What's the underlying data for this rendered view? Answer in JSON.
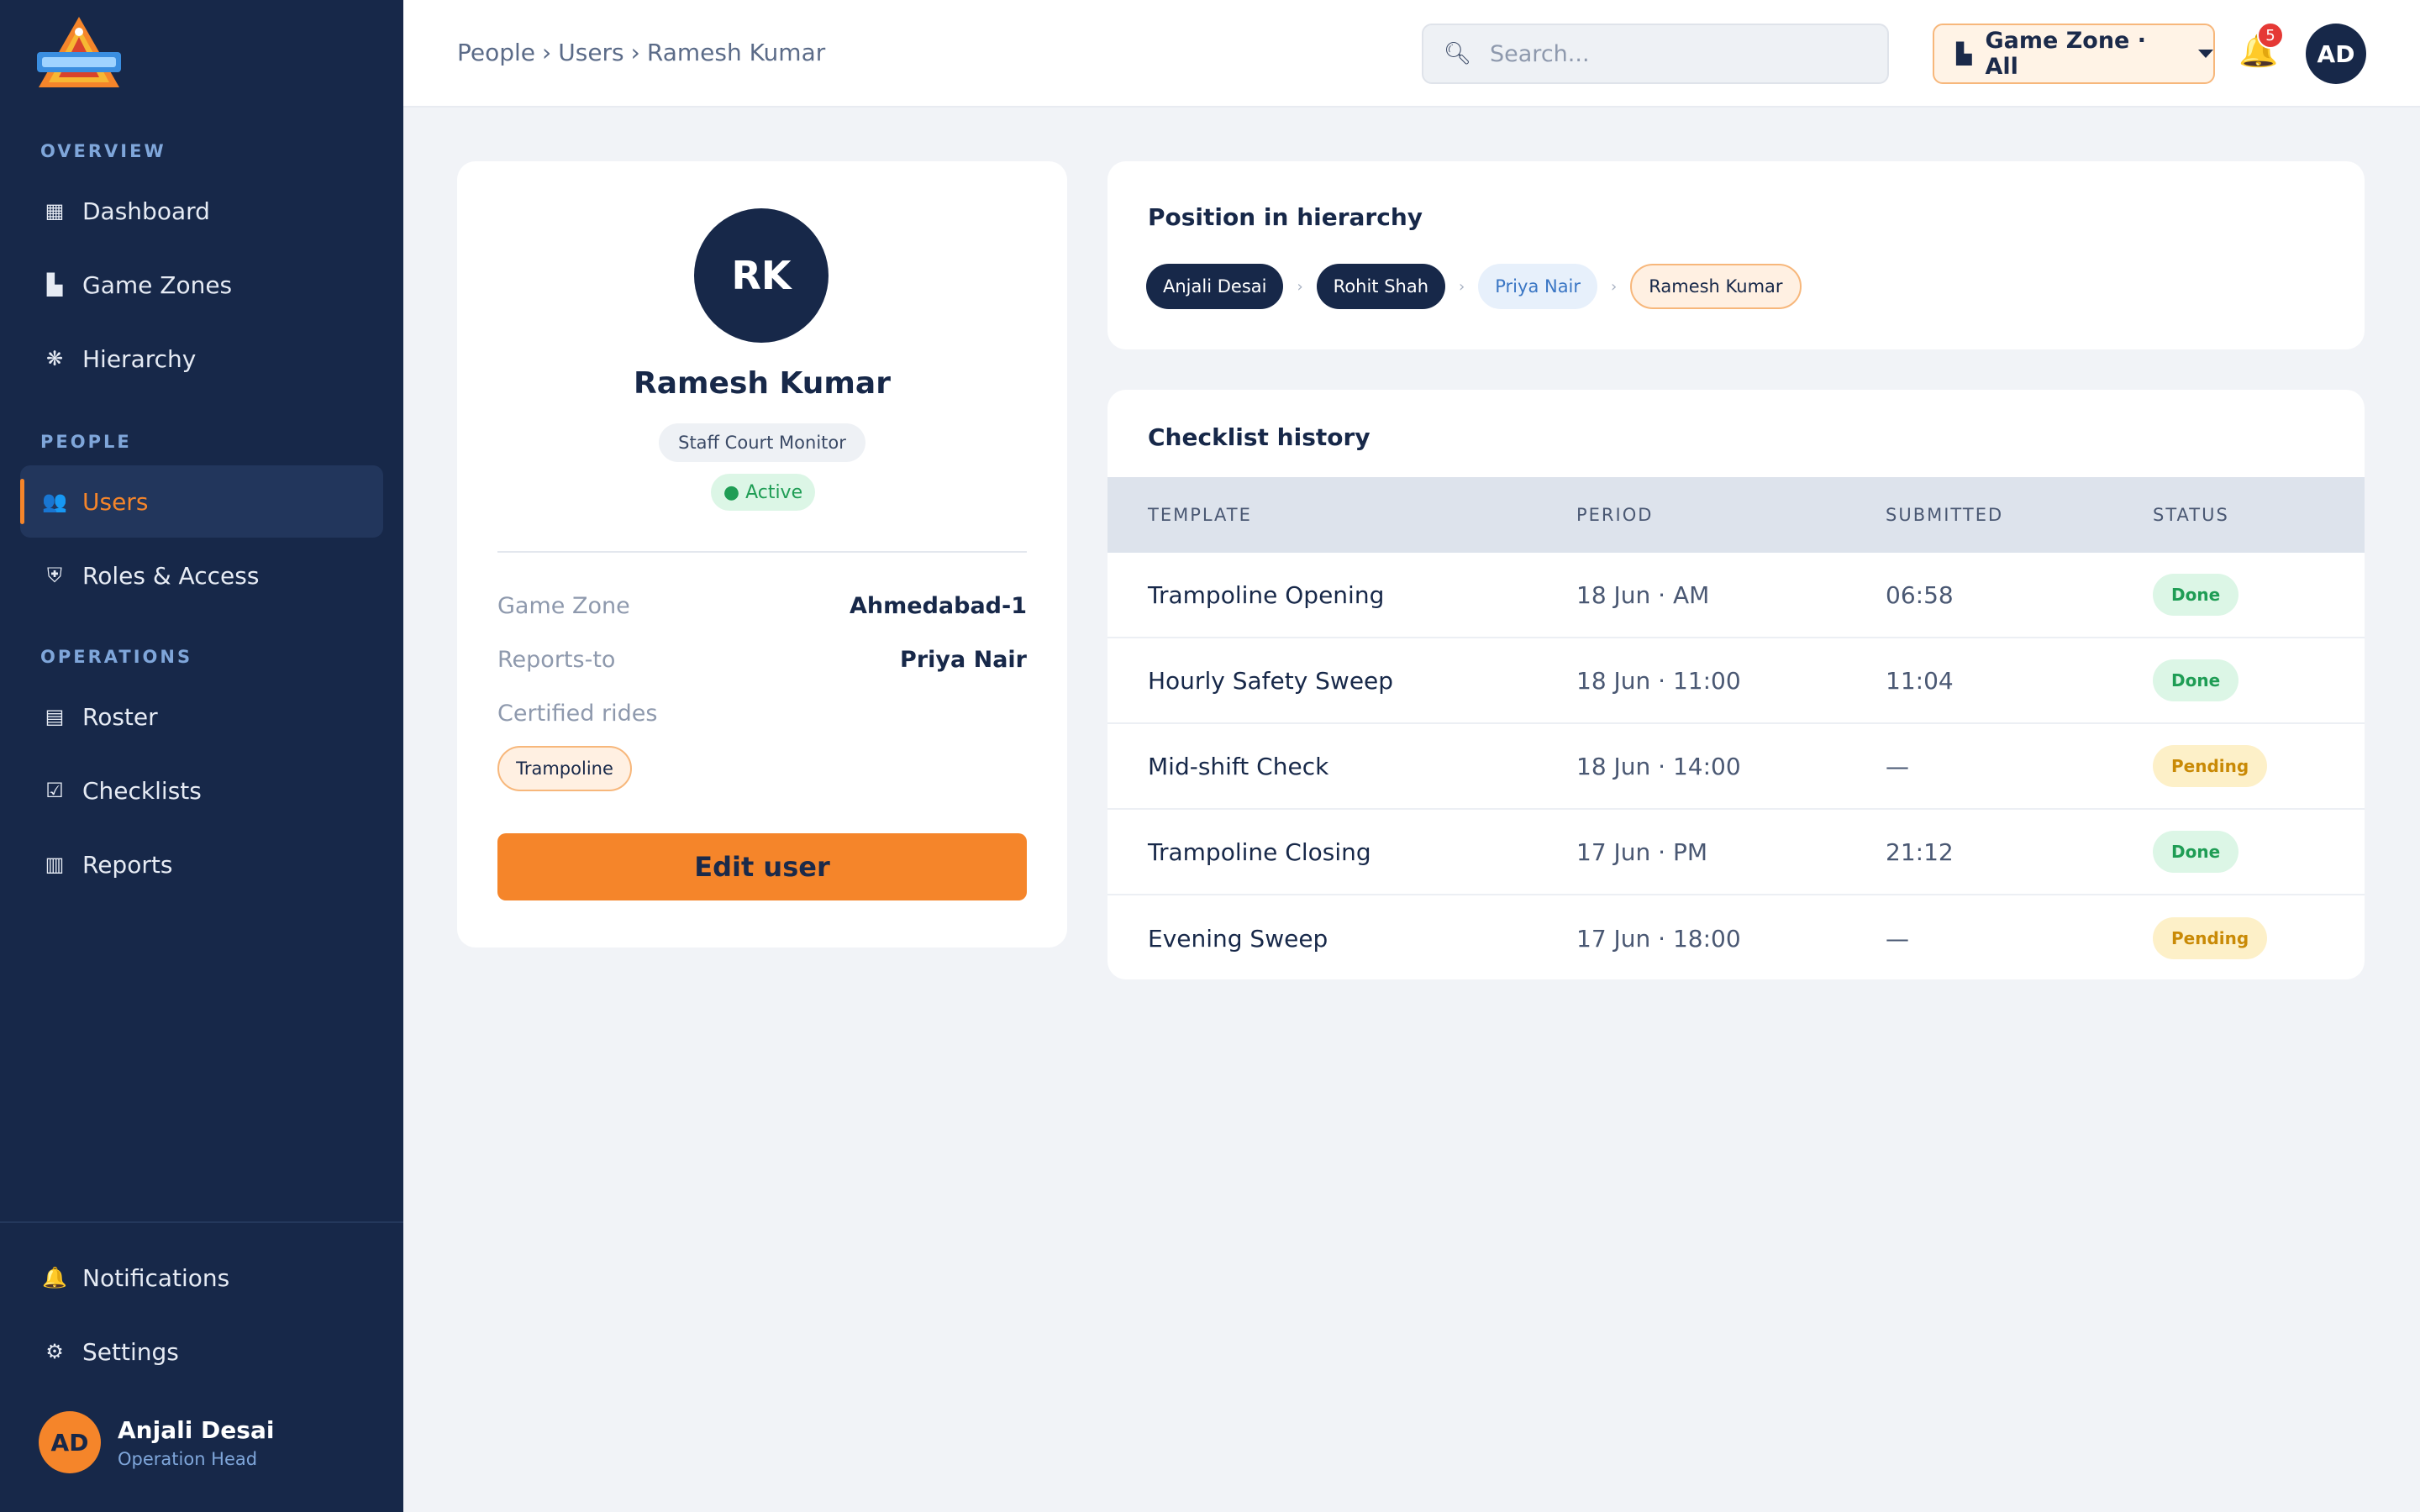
{
  "sidebar": {
    "logo_alt": "Game zone logo",
    "sections": {
      "overview": "OVERVIEW",
      "people": "PEOPLE",
      "operations": "OPERATIONS"
    },
    "items": {
      "dashboard": "Dashboard",
      "game_zones": "Game Zones",
      "hierarchy": "Hierarchy",
      "users": "Users",
      "roles": "Roles & Access",
      "roster": "Roster",
      "checklists": "Checklists",
      "reports": "Reports",
      "notifications": "Notifications",
      "settings": "Settings"
    },
    "active_item": "Users",
    "user": {
      "initials": "AD",
      "name": "Anjali Desai",
      "role": "Operation Head"
    }
  },
  "header": {
    "breadcrumb": [
      "People",
      "Users",
      "Ramesh Kumar"
    ],
    "breadcrumb_sep": "›",
    "search_placeholder": "Search...",
    "zone_selector": "Game Zone · All",
    "notification_count": "5",
    "avatar_initials": "AD"
  },
  "profile": {
    "initials": "RK",
    "name": "Ramesh Kumar",
    "role": "Staff Court Monitor",
    "status": "● Active",
    "fields": {
      "game_zone_label": "Game Zone",
      "game_zone_value": "Ahmedabad-1",
      "reports_to_label": "Reports-to",
      "reports_to_value": "Priya Nair",
      "certified_rides_label": "Certified rides"
    },
    "certified_rides": [
      "Trampoline"
    ],
    "edit_button": "Edit user"
  },
  "hierarchy": {
    "title": "Position in hierarchy",
    "chain": [
      "Anjali Desai",
      "Rohit Shah",
      "Priya Nair",
      "Ramesh Kumar"
    ],
    "separator": "›"
  },
  "checklist": {
    "title": "Checklist history",
    "columns": [
      "TEMPLATE",
      "PERIOD",
      "SUBMITTED",
      "STATUS"
    ],
    "rows": [
      {
        "template": "Trampoline Opening",
        "period": "18 Jun · AM",
        "submitted": "06:58",
        "status": "Done"
      },
      {
        "template": "Hourly Safety Sweep",
        "period": "18 Jun · 11:00",
        "submitted": "11:04",
        "status": "Done"
      },
      {
        "template": "Mid-shift Check",
        "period": "18 Jun · 14:00",
        "submitted": "—",
        "status": "Pending"
      },
      {
        "template": "Trampoline Closing",
        "period": "17 Jun · PM",
        "submitted": "21:12",
        "status": "Done"
      },
      {
        "template": "Evening Sweep",
        "period": "17 Jun · 18:00",
        "submitted": "—",
        "status": "Pending"
      }
    ]
  },
  "colors": {
    "sidebar_bg": "#172849",
    "accent": "#f5852a",
    "done": "#1f9d55",
    "pending": "#c98a06"
  }
}
